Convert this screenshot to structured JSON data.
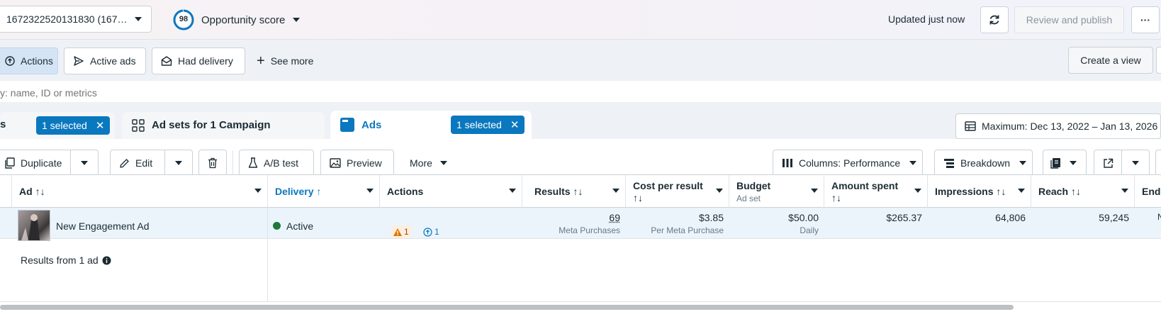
{
  "topbar": {
    "account_label": "1672322520131830 (167…",
    "opportunity_score_value": "98",
    "opportunity_score_label": "Opportunity score",
    "updated_text": "Updated just now",
    "review_publish_label": "Review and publish",
    "more_label": "···"
  },
  "filters": {
    "actions_label": "Actions",
    "active_ads_label": "Active ads",
    "had_delivery_label": "Had delivery",
    "see_more_label": "See more",
    "create_view_label": "Create a view"
  },
  "search": {
    "placeholder": "y: name, ID or metrics"
  },
  "tabs": {
    "campaigns_partial_label": "s",
    "campaigns_selected": "1 selected",
    "adsets_label": "Ad sets for 1 Campaign",
    "ads_label": "Ads",
    "ads_selected": "1 selected",
    "date_range_label": "Maximum: Dec 13, 2022 – Jan 13, 2026"
  },
  "toolbar": {
    "duplicate_label": "Duplicate",
    "edit_label": "Edit",
    "ab_test_label": "A/B test",
    "preview_label": "Preview",
    "more_label": "More",
    "columns_label": "Columns: Performance",
    "breakdown_label": "Breakdown"
  },
  "table": {
    "headers": {
      "ad": "Ad",
      "delivery": "Delivery",
      "actions": "Actions",
      "results": "Results",
      "cost_per_result": "Cost per result",
      "budget": "Budget",
      "budget_sub": "Ad set",
      "amount_spent": "Amount spent",
      "impressions": "Impressions",
      "reach": "Reach",
      "ends": "End"
    },
    "row": {
      "ad_name": "New Engagement Ad",
      "delivery": "Active",
      "warnings_count": "1",
      "actions_count": "1",
      "results": "69",
      "results_sub": "Meta Purchases",
      "cost_per_result": "$3.85",
      "cost_per_result_sub": "Per Meta Purchase",
      "budget": "$50.00",
      "budget_sub": "Daily",
      "amount_spent": "$265.37",
      "impressions": "64,806",
      "reach": "59,245",
      "ends_partial": "N"
    },
    "summary": "Results from 1 ad"
  },
  "colors": {
    "accent": "#0a78be",
    "active_green": "#1d7a3a",
    "warning_orange": "#e07400",
    "row_selected": "#ebf4fb"
  }
}
